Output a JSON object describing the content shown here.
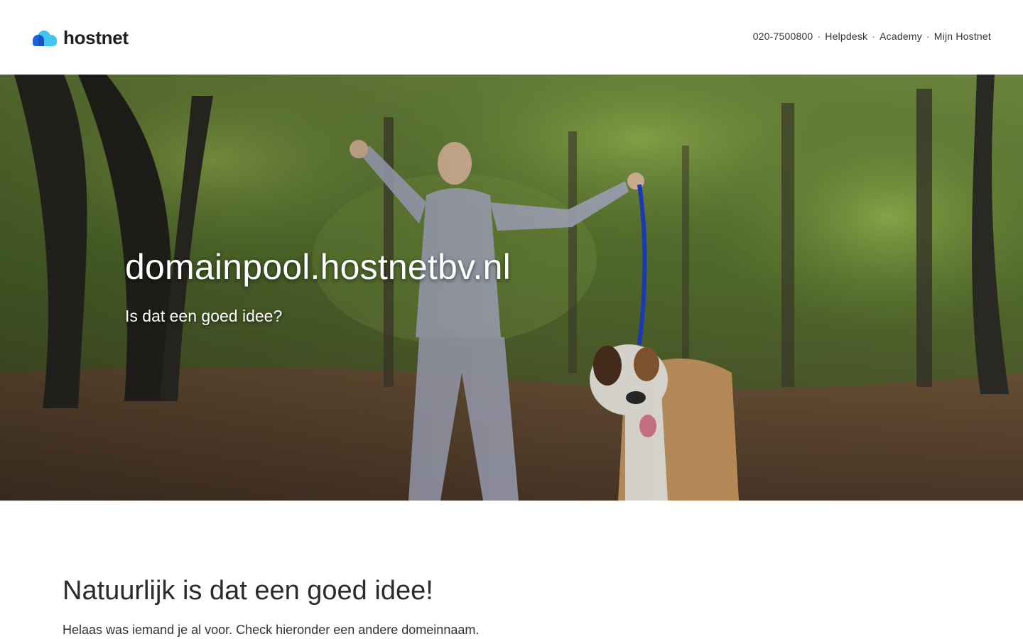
{
  "header": {
    "logo_text": "hostnet",
    "nav": [
      {
        "label": "020-7500800"
      },
      {
        "label": "Helpdesk"
      },
      {
        "label": "Academy"
      },
      {
        "label": "Mijn Hostnet"
      }
    ],
    "separator": "·"
  },
  "hero": {
    "title": "domainpool.hostnetbv.nl",
    "subtitle": "Is dat een goed idee?",
    "image": "man-with-dog-in-forest-photo"
  },
  "content": {
    "title": "Natuurlijk is dat een goed idee!",
    "text": "Helaas was iemand je al voor. Check hieronder een andere domeinnaam."
  },
  "colors": {
    "logo_dark_blue": "#1565d8",
    "logo_light_blue": "#3fc6f0",
    "text_dark": "#2b2b2b"
  }
}
